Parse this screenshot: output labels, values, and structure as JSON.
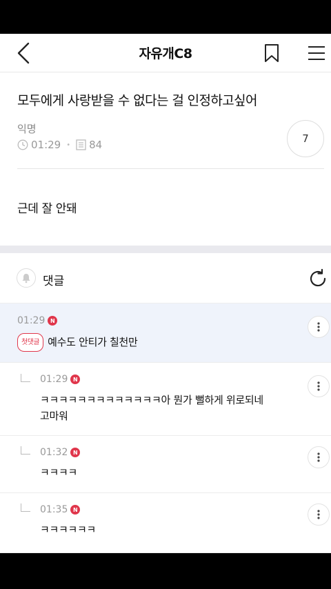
{
  "header": {
    "title": "자유개C8",
    "back_icon": "chevron-left-icon",
    "bookmark_icon": "bookmark-icon",
    "menu_icon": "hamburger-menu-icon"
  },
  "post": {
    "title": "모두에게 사랑받을 수 없다는 걸 인정하고싶어",
    "author": "익명",
    "time": "01:29",
    "views": "84",
    "comment_count": "7",
    "body": "근데 잘 안돼"
  },
  "comments_section": {
    "label": "댓글"
  },
  "comments": [
    {
      "time": "01:29",
      "badge": "N",
      "first_label": "첫댓글",
      "text": "예수도 안티가 칠천만"
    },
    {
      "time": "01:29",
      "badge": "N",
      "line1": "ㅋㅋㅋㅋㅋㅋㅋㅋㅋㅋㅋㅋㅋ아 뭔가 뻘하게 위로되네",
      "line2": "고마워"
    },
    {
      "time": "01:32",
      "badge": "N",
      "text": "ㅋㅋㅋㅋ"
    },
    {
      "time": "01:35",
      "badge": "N",
      "text": "ㅋㅋㅋㅋㅋㅋ"
    }
  ],
  "colors": {
    "accent_red": "#e0364b",
    "highlight_bg": "#eff3fb",
    "section_gap": "#e9e9ee"
  }
}
